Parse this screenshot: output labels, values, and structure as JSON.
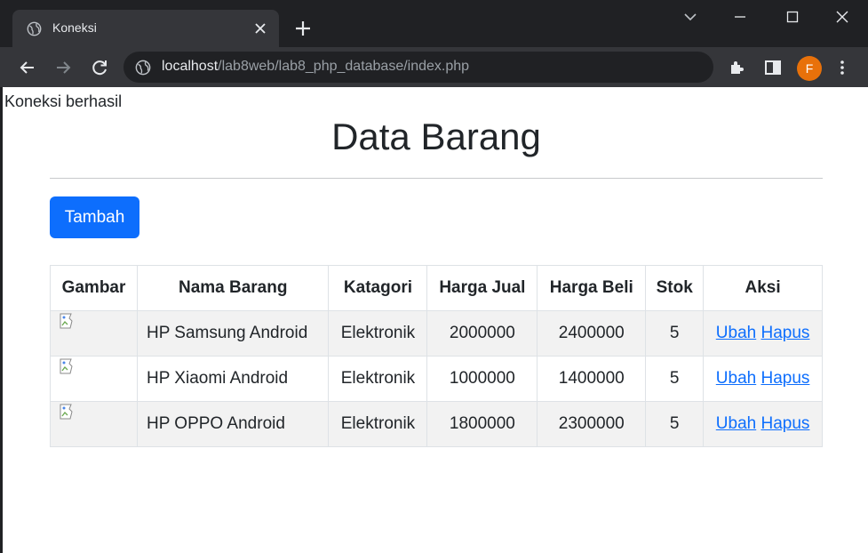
{
  "browser": {
    "tab": {
      "title": "Koneksi"
    },
    "url": {
      "host": "localhost",
      "path": "/lab8web/lab8_php_database/index.php"
    },
    "profile_initial": "F"
  },
  "page": {
    "status_text": "Koneksi berhasil",
    "title": "Data Barang",
    "add_button": "Tambah",
    "table": {
      "headers": [
        "Gambar",
        "Nama Barang",
        "Katagori",
        "Harga Jual",
        "Harga Beli",
        "Stok",
        "Aksi"
      ],
      "rows": [
        {
          "nama": "HP Samsung Android",
          "kategori": "Elektronik",
          "harga_jual": "2000000",
          "harga_beli": "2400000",
          "stok": "5",
          "ubah": "Ubah",
          "hapus": "Hapus"
        },
        {
          "nama": "HP Xiaomi Android",
          "kategori": "Elektronik",
          "harga_jual": "1000000",
          "harga_beli": "1400000",
          "stok": "5",
          "ubah": "Ubah",
          "hapus": "Hapus"
        },
        {
          "nama": "HP OPPO Android",
          "kategori": "Elektronik",
          "harga_jual": "1800000",
          "harga_beli": "2300000",
          "stok": "5",
          "ubah": "Ubah",
          "hapus": "Hapus"
        }
      ]
    }
  },
  "colors": {
    "primary": "#0d6efd",
    "chrome_dark": "#202124",
    "chrome_tab": "#35363a",
    "avatar": "#e8710a"
  }
}
